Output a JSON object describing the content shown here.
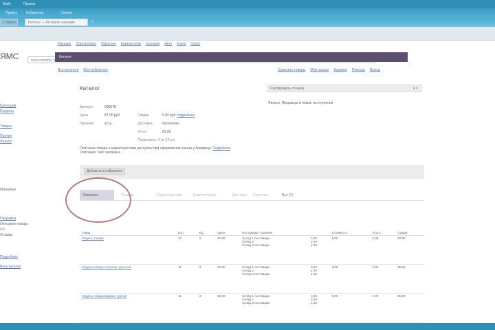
{
  "window": {
    "title_items": [
      "Файл",
      "Правка"
    ],
    "menu": [
      "Правка",
      "Избранное",
      "Сервис"
    ]
  },
  "tabs": [
    "Главная",
    "Каталог — Интернет-магазин"
  ],
  "address": "www.example.ru/catalog/item",
  "site": {
    "logo": "ЯМС",
    "nav": [
      "Магазин",
      "Электроника",
      "Офисное",
      "Компьютеры",
      "Бытовая",
      "Авто",
      "Книги",
      "Спорт"
    ],
    "breadcrumb": "Каталог",
    "subnav": [
      "Все каталоги",
      "Мои избранное"
    ],
    "right_links": [
      "Сравнить товары",
      "Мои заказы",
      "Корзина",
      "Помощь",
      "Выход"
    ]
  },
  "sidebar": {
    "items": [
      "Категории",
      "Разделы",
      "Товары",
      "Прочие",
      "Фильтр",
      "Магазины",
      "Продавец",
      "Описание товара",
      "Отзывы",
      "Подробнее",
      "Весь каталог"
    ],
    "rating": "4.5"
  },
  "product": {
    "title": "Каталог",
    "fields": [
      {
        "label": "Артикул",
        "value": "000578"
      },
      {
        "label": "Цена",
        "value": "87,00 руб."
      },
      {
        "label": "Наличие",
        "value": "есть"
      }
    ],
    "extra": [
      {
        "label": "Скидка",
        "value": "5,00 руб."
      },
      {
        "label": "Доставка",
        "value": "бесплатно"
      },
      {
        "label": "Итого",
        "value": "82,00"
      }
    ],
    "note": "Посмотреть: 5 из 10 шт.",
    "link_details": "подробнее",
    "desc": "Описание товара и характеристики доступны при оформлении заказа у продавца.",
    "desc_link": "Подробнее",
    "desc2": "Описание: сайт магазина",
    "select": "Сортировать по цене",
    "select_note": "Фильтр: Продавцы и новые поступления",
    "section": "Добавить в избранное"
  },
  "subtabs": [
    "Описание",
    "Отзывы",
    "Характеристики",
    "Комплектация",
    "Доставка",
    "Гарантия",
    "Все (7)"
  ],
  "table": {
    "headers": [
      "Товар",
      "Кол.",
      "Ед.",
      "Цена",
      "Поставщик / наличие",
      "",
      "Стоимость",
      "Итого",
      "Сумма"
    ],
    "rows": [
      {
        "name": "Модель товара",
        "qty": "10",
        "u": "2",
        "price": "87,00",
        "lines": [
          "Склад 1 поставщик",
          "Склад 2",
          "Склад 3 поставщик"
        ],
        "c": [
          "5,00",
          "2,00",
          "1,00"
        ],
        "cost": "8,00",
        "total": "2,00",
        "sum": "90,00"
      },
      {
        "name": "Модель товара описание длинное",
        "qty": "11",
        "u": "3",
        "price": "82,00",
        "lines": [
          "Склад 1 поставщик",
          "Склад 2",
          "Склад 3 поставщик"
        ],
        "c": [
          "5,00",
          "2,00",
          "1,00"
        ],
        "cost": "8,00",
        "total": "2,00",
        "sum": "85,00"
      },
      {
        "name": "Модель товара вариант третий",
        "qty": "11",
        "u": "3",
        "price": "82,00",
        "lines": [
          "Склад 1 поставщик",
          "Склад 2",
          "Склад 3 поставщик"
        ],
        "c": [
          "5,00",
          "2,00",
          "1,00"
        ],
        "cost": "8,00",
        "total": "2,00",
        "sum": "85,00"
      }
    ]
  },
  "colors": {
    "titlebar": "#2f8fb5",
    "header": "#5c4f6e",
    "circle": "#a5504f"
  }
}
